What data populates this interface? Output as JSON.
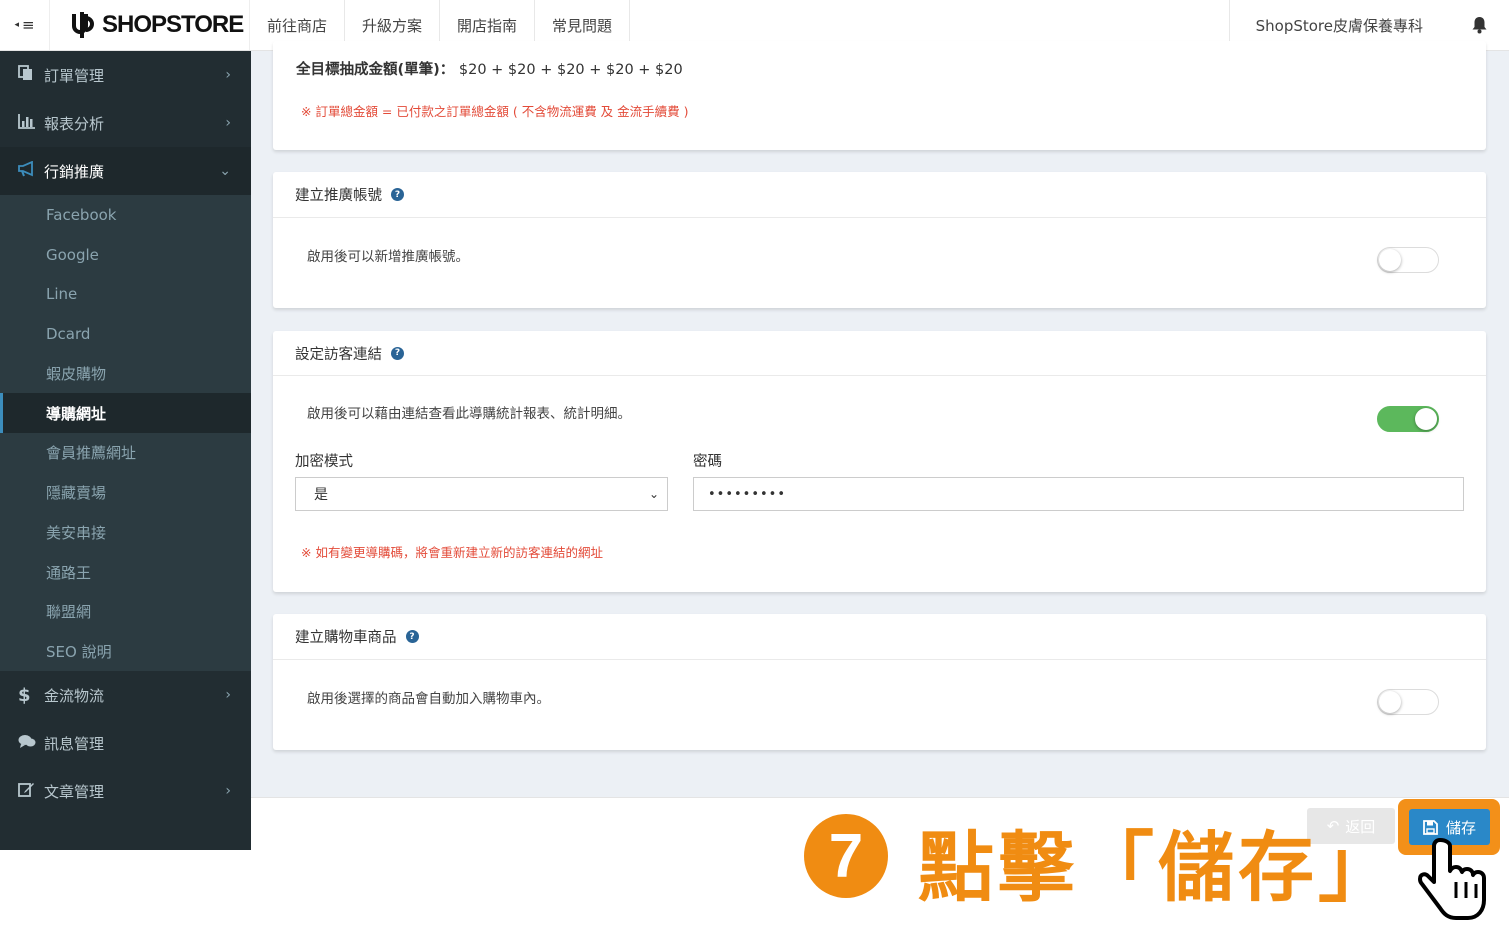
{
  "topbar": {
    "toggle_icon": "≡",
    "logo_text": "SHOPSTORE",
    "nav": [
      "前往商店",
      "升級方案",
      "開店指南",
      "常見問題"
    ],
    "store_name": "ShopStore皮膚保養專科"
  },
  "sidebar": {
    "items_top": [
      {
        "label": "訂單管理",
        "icon": "files-icon"
      },
      {
        "label": "報表分析",
        "icon": "bar-chart-icon"
      },
      {
        "label": "行銷推廣",
        "icon": "bullhorn-icon"
      }
    ],
    "submenu": [
      "Facebook",
      "Google",
      "Line",
      "Dcard",
      "蝦皮購物",
      "導購網址",
      "會員推薦網址",
      "隱藏賣場",
      "美安串接",
      "通路王",
      "聯盟網",
      "SEO 說明"
    ],
    "current_sub": "導購網址",
    "items_bottom": [
      {
        "label": "金流物流",
        "icon": "dollar-icon"
      },
      {
        "label": "訊息管理",
        "icon": "comments-icon"
      },
      {
        "label": "文章管理",
        "icon": "edit-icon"
      }
    ]
  },
  "card1": {
    "commission_label": "全目標抽成金額(單筆)：",
    "commission_value": "$20 + $20 + $20 + $20 + $20",
    "note": "※ 訂單總金額 = 已付款之訂單總金額 ( 不含物流運費 及 金流手續費 )"
  },
  "card2": {
    "title": "建立推廣帳號",
    "desc": "啟用後可以新增推廣帳號。",
    "enabled": false
  },
  "card3": {
    "title": "設定訪客連結",
    "desc": "啟用後可以藉由連結查看此導購統計報表、統計明細。",
    "enabled": true,
    "encrypt_label": "加密模式",
    "encrypt_value": "是",
    "password_label": "密碼",
    "password_value": "•••••••••",
    "note": "※ 如有變更導購碼，將會重新建立新的訪客連結的網址"
  },
  "card4": {
    "title": "建立購物車商品",
    "desc": "啟用後選擇的商品會自動加入購物車內。",
    "enabled": false
  },
  "footer": {
    "back_label": "返回",
    "save_label": "儲存"
  },
  "annotation": {
    "step_number": "7",
    "text": "點擊「儲存」"
  },
  "colors": {
    "sidebar_bg": "#222d32",
    "accent_blue": "#2a88c8",
    "switch_on": "#5cb85c",
    "note_red": "#e34b39",
    "annotation_orange": "#f08c12"
  }
}
